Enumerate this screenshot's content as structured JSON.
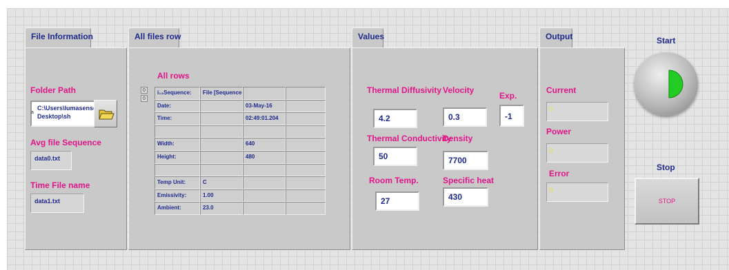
{
  "file_info": {
    "tab": "File Information",
    "folder_path_label": "Folder Path",
    "folder_path_line1": "C:\\Users\\lumasense\\",
    "folder_path_line2": "Desktop\\sh",
    "avg_seq_label": "Avg file Sequence",
    "avg_seq_value": "data0.txt",
    "time_file_label": "Time File name",
    "time_file_value": "data1.txt"
  },
  "all_files": {
    "tab": "All files row",
    "title": "All rows",
    "rows": [
      [
        "i₁₃Sequence:",
        "File [Sequence-",
        "",
        ""
      ],
      [
        "Date:",
        "",
        "03-May-16",
        ""
      ],
      [
        "Time:",
        "",
        "02:49:01.204",
        ""
      ],
      [
        "",
        "",
        "",
        ""
      ],
      [
        "Width:",
        "",
        "640",
        ""
      ],
      [
        "Height:",
        "",
        "480",
        ""
      ],
      [
        "",
        "",
        "",
        ""
      ],
      [
        "Temp Unit:",
        "C",
        "",
        ""
      ],
      [
        "Emissivity:",
        "1.00",
        "",
        ""
      ],
      [
        "Ambient:",
        "23.0",
        "",
        ""
      ]
    ],
    "spin_top": "0",
    "spin_bottom": "0"
  },
  "values": {
    "tab": "Values",
    "thermal_diffusivity_label": "Thermal Diffusivity",
    "thermal_diffusivity": "4.2",
    "velocity_label": "Velocity",
    "velocity": "0.3",
    "exp_label": "Exp.",
    "exp": "-1",
    "thermal_conductivity_label": "Thermal Conductivity",
    "thermal_conductivity": "50",
    "density_label": "Density",
    "density": "7700",
    "room_temp_label": "Room Temp.",
    "room_temp": "27",
    "specific_heat_label": "Specific heat",
    "specific_heat": "430"
  },
  "output": {
    "tab": "Output",
    "current_label": "Current",
    "current": "0",
    "power_label": "Power",
    "power": "0",
    "error_label": "Error",
    "error": "0"
  },
  "controls": {
    "start_label": "Start",
    "stop_label": "Stop",
    "stop_button": "STOP"
  },
  "colors": {
    "accent_pink": "#e0168a",
    "label_blue": "#1e2a8c",
    "start_green": "#22cc22"
  }
}
